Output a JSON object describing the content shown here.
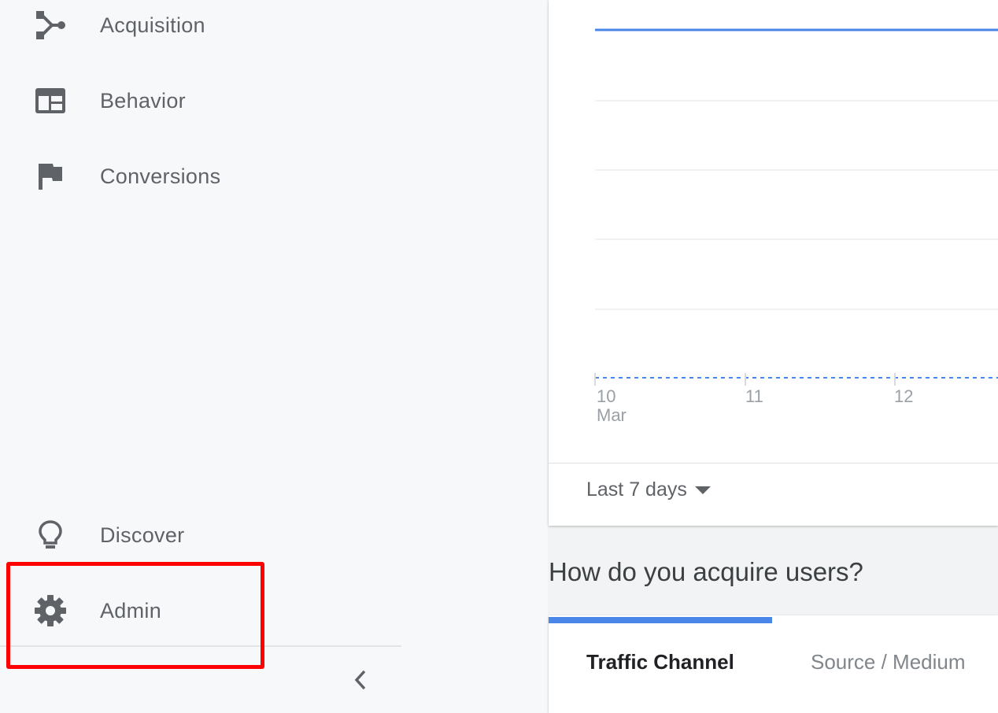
{
  "sidebar": {
    "items": [
      {
        "label": "Acquisition",
        "icon": "acquisition-icon"
      },
      {
        "label": "Behavior",
        "icon": "behavior-icon"
      },
      {
        "label": "Conversions",
        "icon": "flag-icon"
      },
      {
        "label": "Discover",
        "icon": "lightbulb-icon"
      },
      {
        "label": "Admin",
        "icon": "gear-icon"
      }
    ],
    "collapse_icon": "chevron-left-icon"
  },
  "chart": {
    "x_ticks": [
      {
        "day": "10",
        "month": "Mar"
      },
      {
        "day": "11"
      },
      {
        "day": "12"
      }
    ],
    "line_color": "#4a86e8",
    "range_label": "Last 7 days"
  },
  "acquisition": {
    "title": "How do you acquire users?",
    "tabs": [
      "Traffic Channel",
      "Source / Medium"
    ],
    "active_tab": "Traffic Channel",
    "accent_color": "#4a86e8"
  },
  "highlight_color": "#ff0000"
}
